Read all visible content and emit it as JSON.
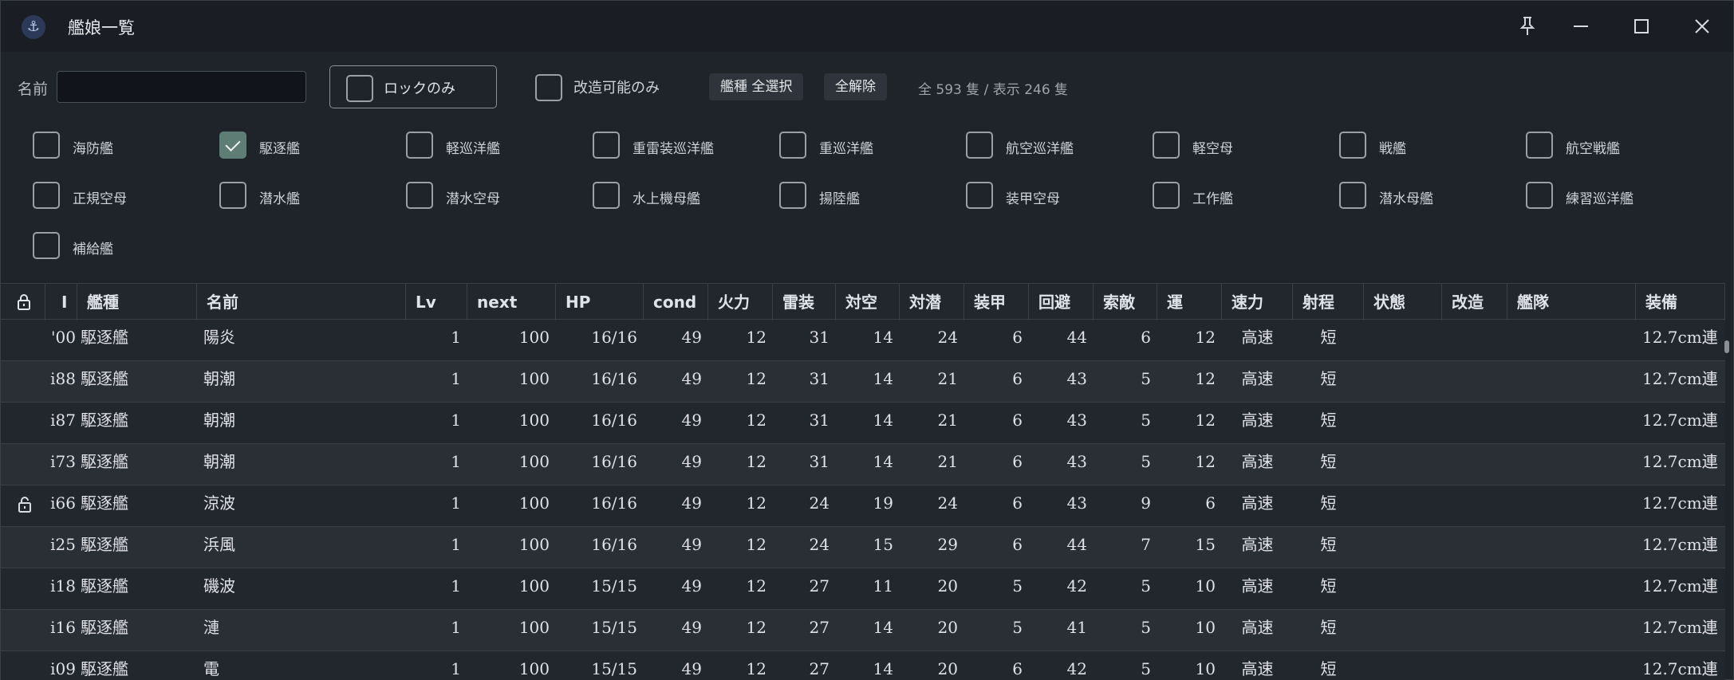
{
  "window": {
    "title": "艦娘一覧",
    "icon": "anchor-icon"
  },
  "filter": {
    "name_label": "名前",
    "name_value": "",
    "lock_only_label": "ロックのみ",
    "lock_only_checked": false,
    "remodel_label": "改造可能のみ",
    "remodel_checked": false,
    "select_all_label": "艦種 全選択",
    "clear_all_label": "全解除",
    "count_text": "全 593 隻 / 表示 246 隻"
  },
  "ship_types": [
    {
      "label": "海防艦",
      "checked": false
    },
    {
      "label": "駆逐艦",
      "checked": true
    },
    {
      "label": "軽巡洋艦",
      "checked": false
    },
    {
      "label": "重雷装巡洋艦",
      "checked": false
    },
    {
      "label": "重巡洋艦",
      "checked": false
    },
    {
      "label": "航空巡洋艦",
      "checked": false
    },
    {
      "label": "軽空母",
      "checked": false
    },
    {
      "label": "戦艦",
      "checked": false
    },
    {
      "label": "航空戦艦",
      "checked": false
    },
    {
      "label": "正規空母",
      "checked": false
    },
    {
      "label": "潜水艦",
      "checked": false
    },
    {
      "label": "潜水空母",
      "checked": false
    },
    {
      "label": "水上機母艦",
      "checked": false
    },
    {
      "label": "揚陸艦",
      "checked": false
    },
    {
      "label": "装甲空母",
      "checked": false
    },
    {
      "label": "工作艦",
      "checked": false
    },
    {
      "label": "潜水母艦",
      "checked": false
    },
    {
      "label": "練習巡洋艦",
      "checked": false
    },
    {
      "label": "補給艦",
      "checked": false
    }
  ],
  "table": {
    "headers": [
      "I",
      "艦種",
      "名前",
      "Lv",
      "next",
      "HP",
      "cond",
      "火力",
      "雷装",
      "対空",
      "対潜",
      "装甲",
      "回避",
      "索敵",
      "運",
      "速力",
      "射程",
      "状態",
      "改造",
      "艦隊",
      "装備"
    ],
    "rows": [
      {
        "locked": false,
        "id": "'00",
        "type": "駆逐艦",
        "name": "陽炎",
        "lv": "1",
        "next": "100",
        "hp": "16/16",
        "cond": "49",
        "fire": "12",
        "torp": "31",
        "aa": "14",
        "asw": "24",
        "armor": "6",
        "evasion": "44",
        "los": "6",
        "luck": "12",
        "speed": "高速",
        "range": "短",
        "equip": "12.7cm連"
      },
      {
        "locked": false,
        "id": "i88",
        "type": "駆逐艦",
        "name": "朝潮",
        "lv": "1",
        "next": "100",
        "hp": "16/16",
        "cond": "49",
        "fire": "12",
        "torp": "31",
        "aa": "14",
        "asw": "21",
        "armor": "6",
        "evasion": "43",
        "los": "5",
        "luck": "12",
        "speed": "高速",
        "range": "短",
        "equip": "12.7cm連"
      },
      {
        "locked": false,
        "id": "i87",
        "type": "駆逐艦",
        "name": "朝潮",
        "lv": "1",
        "next": "100",
        "hp": "16/16",
        "cond": "49",
        "fire": "12",
        "torp": "31",
        "aa": "14",
        "asw": "21",
        "armor": "6",
        "evasion": "43",
        "los": "5",
        "luck": "12",
        "speed": "高速",
        "range": "短",
        "equip": "12.7cm連"
      },
      {
        "locked": false,
        "id": "i73",
        "type": "駆逐艦",
        "name": "朝潮",
        "lv": "1",
        "next": "100",
        "hp": "16/16",
        "cond": "49",
        "fire": "12",
        "torp": "31",
        "aa": "14",
        "asw": "21",
        "armor": "6",
        "evasion": "43",
        "los": "5",
        "luck": "12",
        "speed": "高速",
        "range": "短",
        "equip": "12.7cm連"
      },
      {
        "locked": true,
        "id": "i66",
        "type": "駆逐艦",
        "name": "涼波",
        "lv": "1",
        "next": "100",
        "hp": "16/16",
        "cond": "49",
        "fire": "12",
        "torp": "24",
        "aa": "19",
        "asw": "24",
        "armor": "6",
        "evasion": "43",
        "los": "9",
        "luck": "6",
        "speed": "高速",
        "range": "短",
        "equip": "12.7cm連"
      },
      {
        "locked": false,
        "id": "i25",
        "type": "駆逐艦",
        "name": "浜風",
        "lv": "1",
        "next": "100",
        "hp": "16/16",
        "cond": "49",
        "fire": "12",
        "torp": "24",
        "aa": "15",
        "asw": "29",
        "armor": "6",
        "evasion": "44",
        "los": "7",
        "luck": "15",
        "speed": "高速",
        "range": "短",
        "equip": "12.7cm連"
      },
      {
        "locked": false,
        "id": "i18",
        "type": "駆逐艦",
        "name": "磯波",
        "lv": "1",
        "next": "100",
        "hp": "15/15",
        "cond": "49",
        "fire": "12",
        "torp": "27",
        "aa": "11",
        "asw": "20",
        "armor": "5",
        "evasion": "42",
        "los": "5",
        "luck": "10",
        "speed": "高速",
        "range": "短",
        "equip": "12.7cm連"
      },
      {
        "locked": false,
        "id": "i16",
        "type": "駆逐艦",
        "name": "漣",
        "lv": "1",
        "next": "100",
        "hp": "15/15",
        "cond": "49",
        "fire": "12",
        "torp": "27",
        "aa": "14",
        "asw": "20",
        "armor": "5",
        "evasion": "41",
        "los": "5",
        "luck": "10",
        "speed": "高速",
        "range": "短",
        "equip": "12.7cm連"
      },
      {
        "locked": false,
        "id": "i09",
        "type": "駆逐艦",
        "name": "電",
        "lv": "1",
        "next": "100",
        "hp": "15/15",
        "cond": "49",
        "fire": "12",
        "torp": "27",
        "aa": "14",
        "asw": "20",
        "armor": "6",
        "evasion": "42",
        "los": "5",
        "luck": "10",
        "speed": "高速",
        "range": "短",
        "equip": "12.7cm連"
      }
    ]
  }
}
